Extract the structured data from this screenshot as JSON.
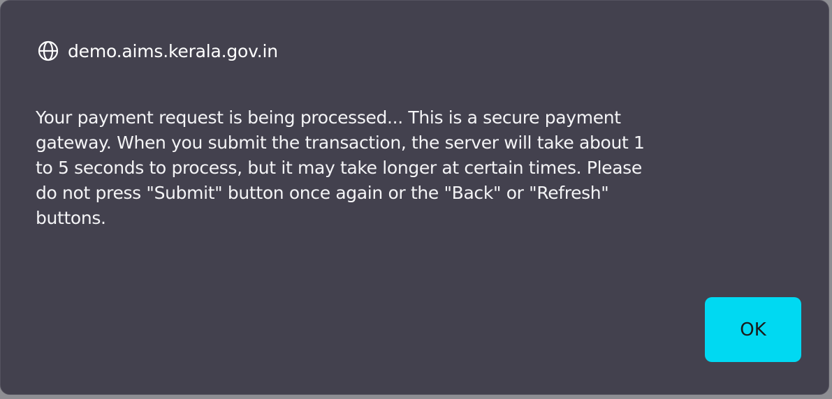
{
  "dialog": {
    "origin": "demo.aims.kerala.gov.in",
    "origin_icon": "globe-icon",
    "message": "Your payment request is being processed... This is a secure payment\ngateway. When you submit the transaction, the server will take about 1\nto 5 seconds to process, but it may take longer at certain times. Please\ndo not press \"Submit\" button once again or the \"Back\" or \"Refresh\"\nbuttons.",
    "ok_label": "OK"
  },
  "colors": {
    "dialog_background": "#43414e",
    "button_accent": "#00d9f2",
    "text": "#ffffff"
  }
}
